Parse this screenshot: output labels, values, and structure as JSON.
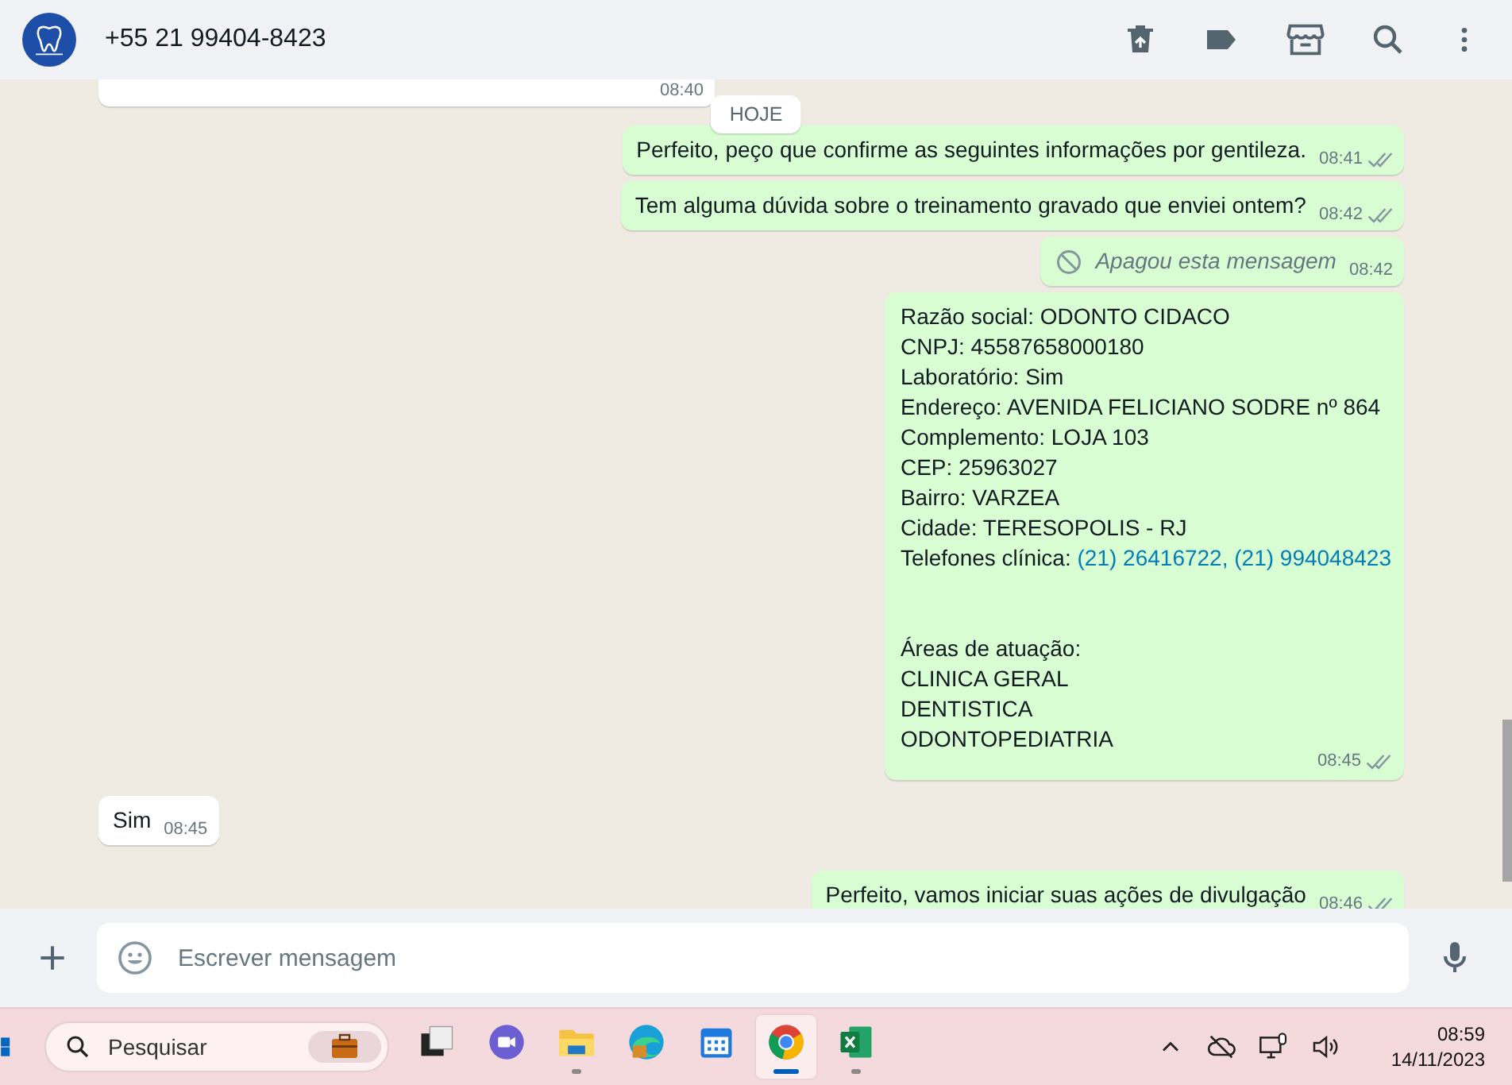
{
  "header": {
    "contact": "+55 21 99404-8423"
  },
  "chat": {
    "date_chip": "HOJE",
    "messages": [
      {
        "kind": "incoming",
        "time": "08:40"
      },
      {
        "kind": "outgoing",
        "text": "Perfeito, peço que confirme as seguintes informações por gentileza.",
        "time": "08:41",
        "read": false
      },
      {
        "kind": "outgoing",
        "text": "Tem alguma dúvida sobre o treinamento gravado que enviei ontem?",
        "time": "08:42",
        "read": false
      },
      {
        "kind": "deleted",
        "text": "Apagou esta mensagem",
        "time": "08:42"
      },
      {
        "kind": "outgoing",
        "time": "08:45",
        "read": false,
        "lines": [
          {
            "text": "Razão social: ODONTO CIDACO"
          },
          {
            "text": "CNPJ: 45587658000180"
          },
          {
            "text": "Laboratório: Sim"
          },
          {
            "text": "Endereço: AVENIDA FELICIANO SODRE nº 864"
          },
          {
            "text": "Complemento: LOJA 103"
          },
          {
            "text": "CEP: 25963027"
          },
          {
            "text": "Bairro: VARZEA"
          },
          {
            "text": "Cidade: TERESOPOLIS - RJ"
          },
          {
            "text": "Telefones clínica:",
            "links": [
              "(21) 26416722",
              "(21) 994048423"
            ],
            "separator": ", "
          },
          {
            "text": "Áreas de atuação:",
            "gap_before": true
          },
          {
            "text": "CLINICA GERAL"
          },
          {
            "text": "DENTISTICA"
          },
          {
            "text": "ODONTOPEDIATRIA"
          }
        ]
      },
      {
        "kind": "incoming",
        "text": "Sim",
        "time": "08:45"
      },
      {
        "kind": "outgoing",
        "text": "Perfeito, vamos iniciar suas ações de divulgação",
        "time": "08:46",
        "read": false
      }
    ]
  },
  "composer": {
    "placeholder": "Escrever mensagem"
  },
  "taskbar": {
    "search_placeholder": "Pesquisar",
    "apps": [
      {
        "kind": "window",
        "open": false,
        "selected": false
      },
      {
        "kind": "chat",
        "open": false,
        "selected": false
      },
      {
        "kind": "folder",
        "open": true,
        "selected": false
      },
      {
        "kind": "globe",
        "open": false,
        "selected": false
      },
      {
        "kind": "calendar",
        "open": false,
        "selected": false
      },
      {
        "kind": "browser",
        "open": true,
        "selected": true
      },
      {
        "kind": "sheet",
        "open": true,
        "selected": false
      }
    ],
    "time": "08:59",
    "date": "14/11/2023"
  }
}
